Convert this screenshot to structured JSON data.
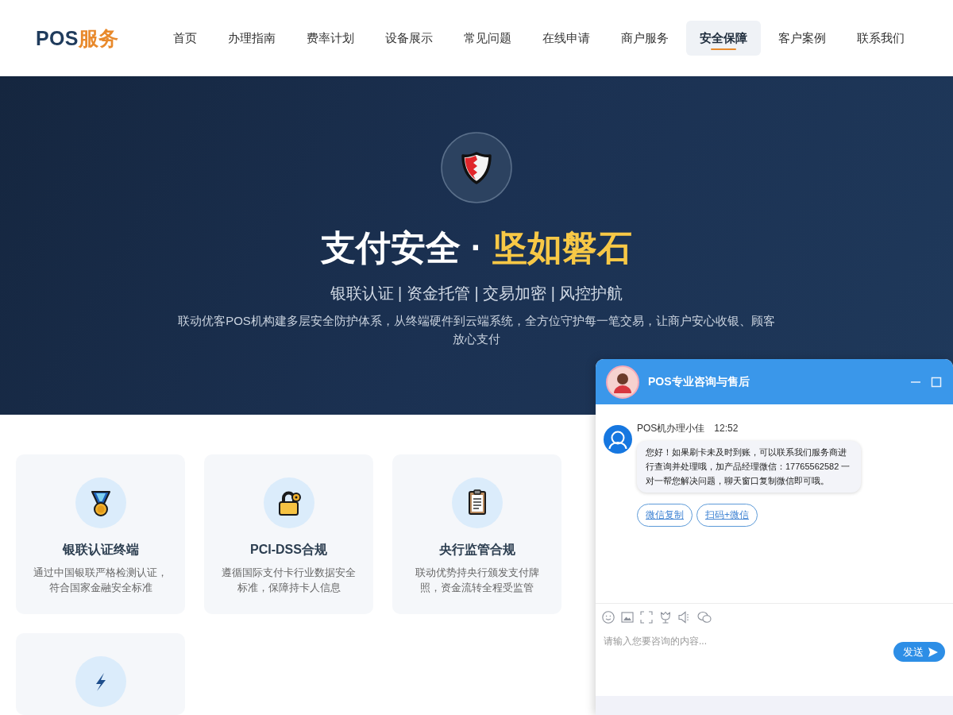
{
  "header": {
    "logo": {
      "primary": "POS",
      "accent": "服务"
    },
    "nav": [
      {
        "label": "首页",
        "selected": false
      },
      {
        "label": "办理指南",
        "selected": false
      },
      {
        "label": "费率计划",
        "selected": false
      },
      {
        "label": "设备展示",
        "selected": false
      },
      {
        "label": "常见问题",
        "selected": false
      },
      {
        "label": "在线申请",
        "selected": false
      },
      {
        "label": "商户服务",
        "selected": false
      },
      {
        "label": "安全保障",
        "selected": true
      },
      {
        "label": "客户案例",
        "selected": false
      },
      {
        "label": "联系我们",
        "selected": false
      }
    ]
  },
  "hero": {
    "title": "支付安全 ·",
    "title_highlight": "坚如磐石",
    "subtitle": "银联认证 | 资金托管 | 交易加密 | 风控护航",
    "description": "联动优客POS机构建多层安全防护体系，从终端硬件到云端系统，全方位守护每一笔交易，让商户安心收银、顾客放心支付"
  },
  "features": [
    {
      "kind": "medal",
      "title": "银联认证终端",
      "description": "通过中国银联严格检测认证，符合国家金融安全标准"
    },
    {
      "kind": "padlock",
      "title": "PCI-DSS合规",
      "description": "遵循国际支付卡行业数据安全标准，保障持卡人信息"
    },
    {
      "kind": "clipboard",
      "title": "央行监管合规",
      "description": "联动优势持央行颁发支付牌照，资金流转全程受监管"
    },
    {
      "kind": "lightning"
    }
  ],
  "chat": {
    "title": "POS专业咨询与售后",
    "messages": [
      {
        "sender": "POS机办理小佳",
        "time": "12:52",
        "text": "您好！如果刷卡未及时到账，可以联系我们服务商进行查询并处理哦，加产品经理微信：17765562582 一对一帮您解决问题，聊天窗口复制微信即可哦。",
        "quick_replies": [
          "微信复制",
          "扫码+微信"
        ]
      }
    ],
    "input": {
      "placeholder": "请输入您要咨询的内容..."
    },
    "send_button": "发送"
  }
}
